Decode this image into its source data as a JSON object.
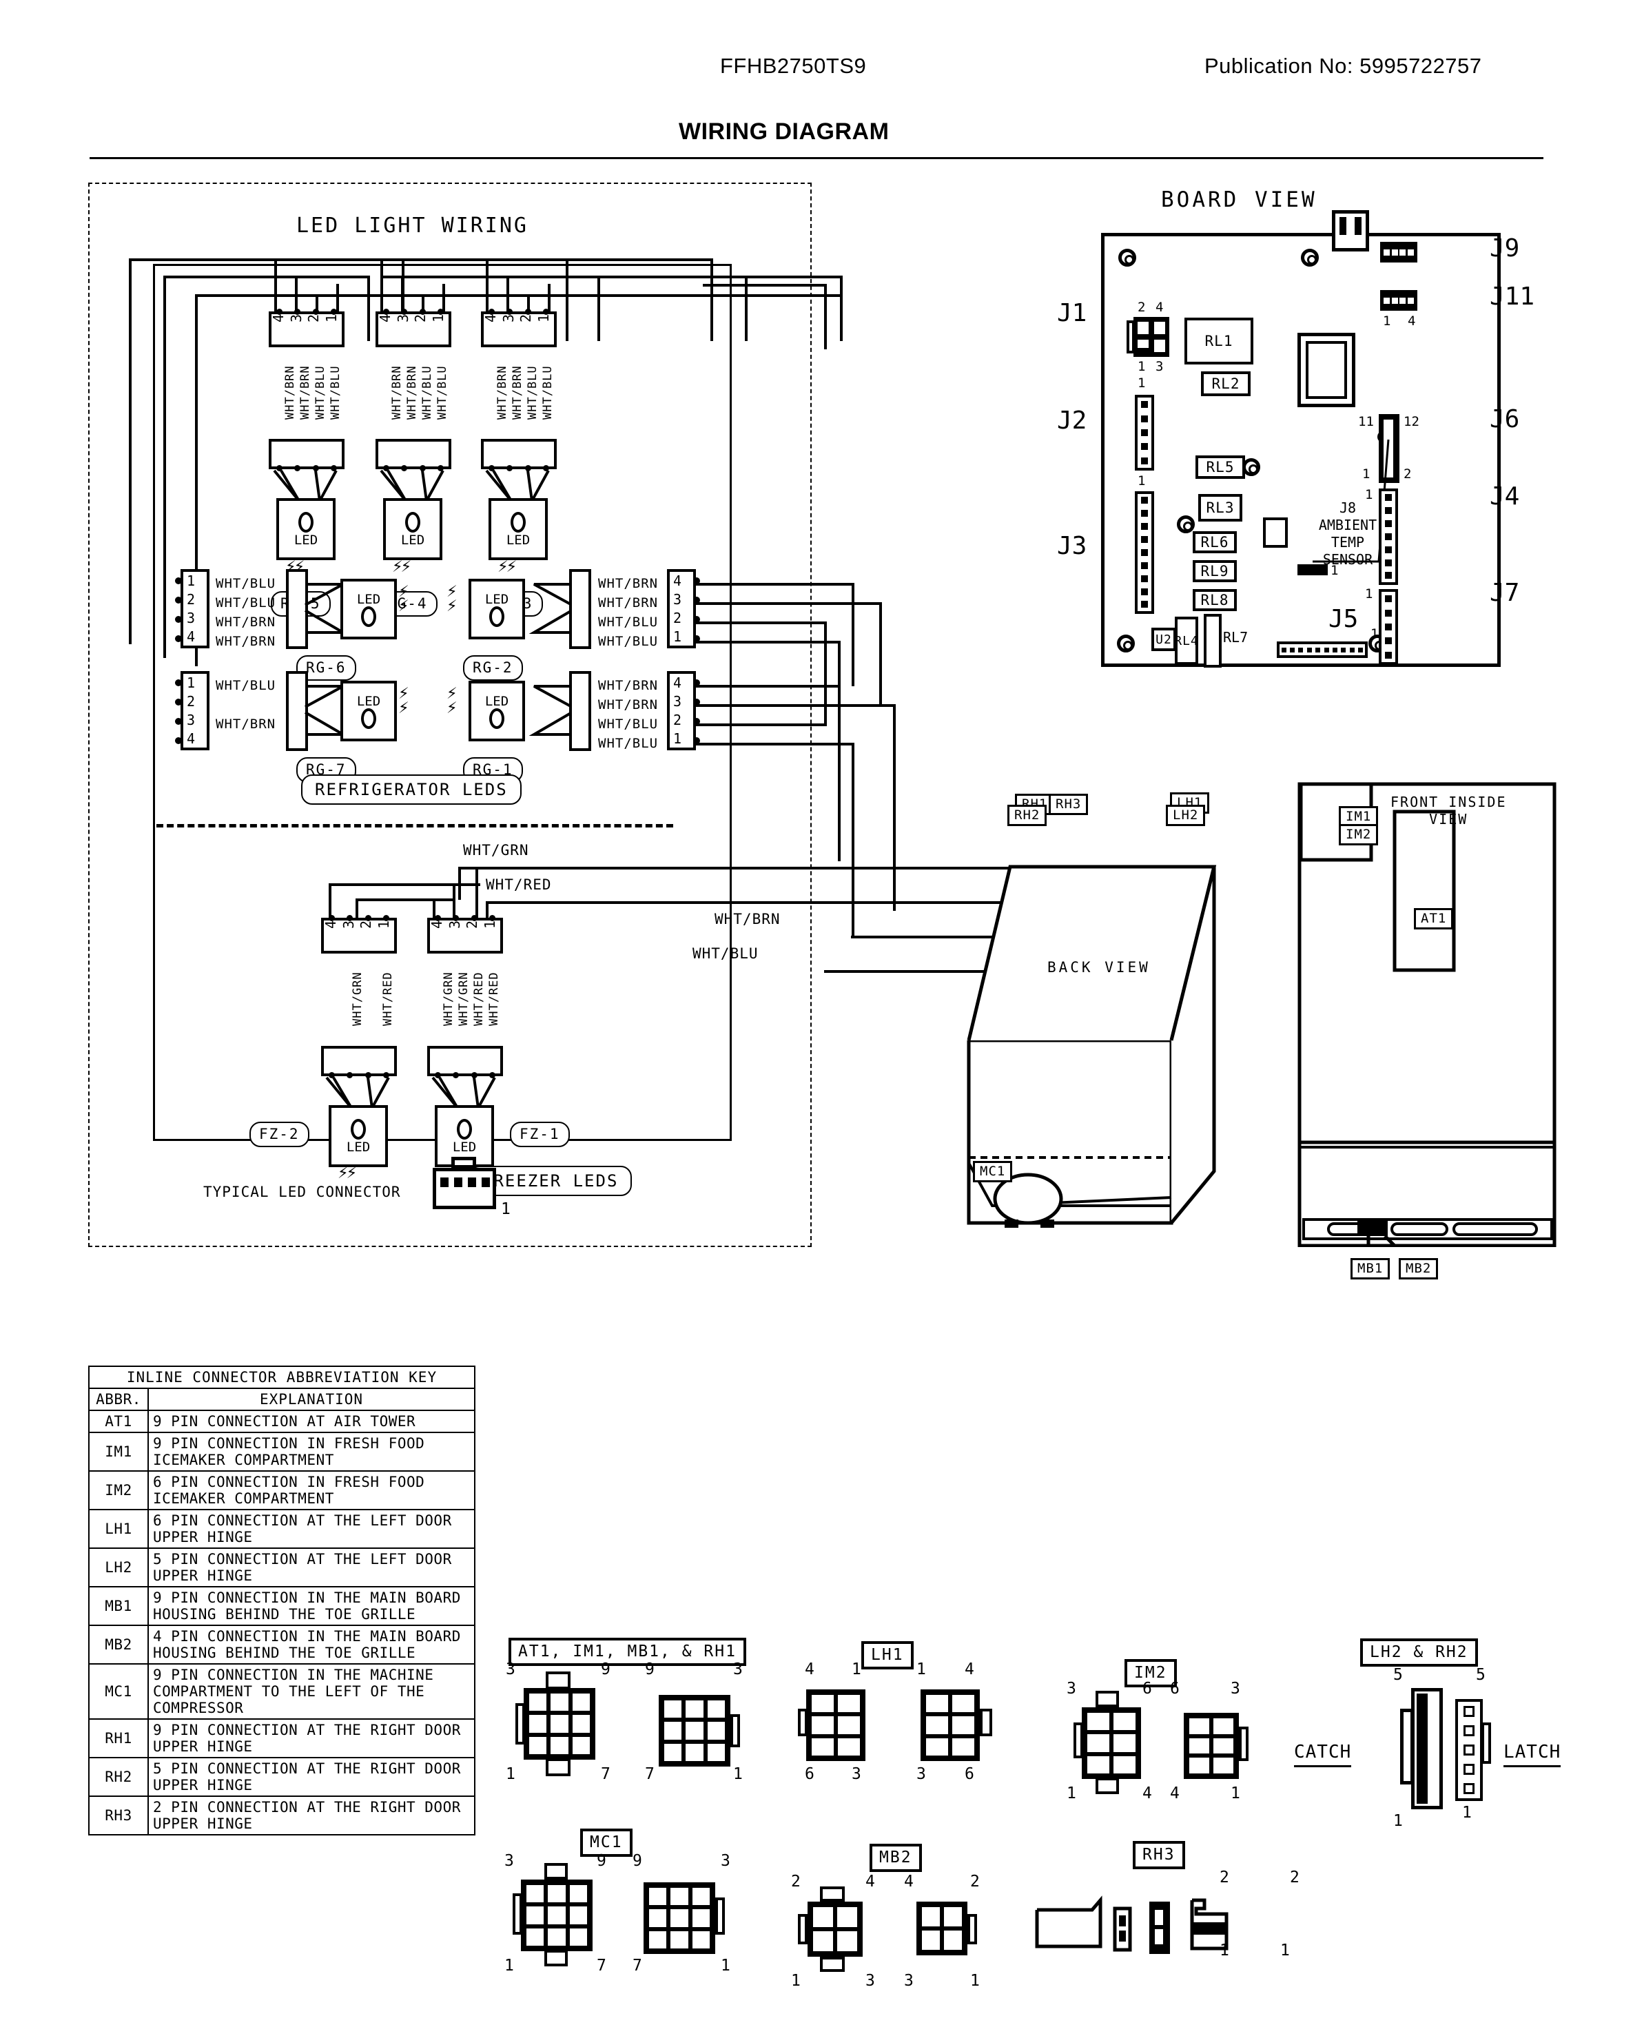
{
  "header": {
    "model": "FFHB2750TS9",
    "publication": "Publication No:  5995722757",
    "title": "WIRING DIAGRAM"
  },
  "led_panel": {
    "title": "LED LIGHT WIRING",
    "refrigerator_leds_label": "REFRIGERATOR LEDS",
    "freezer_leds_label": "FREEZER LEDS",
    "typical_connector_label": "TYPICAL LED CONNECTOR",
    "typical_connector_pin": "1",
    "led_text": "LED",
    "top_connectors": [
      {
        "tag": "RG-5",
        "pins": [
          "4",
          "3",
          "2",
          "1"
        ],
        "wires": [
          "WHT/BRN",
          "WHT/BRN",
          "WHT/BLU",
          "WHT/BLU"
        ]
      },
      {
        "tag": "RG-4",
        "pins": [
          "4",
          "3",
          "2",
          "1"
        ],
        "wires": [
          "WHT/BRN",
          "WHT/BRN",
          "WHT/BLU",
          "WHT/BLU"
        ]
      },
      {
        "tag": "RG-3",
        "pins": [
          "4",
          "3",
          "2",
          "1"
        ],
        "wires": [
          "WHT/BRN",
          "WHT/BRN",
          "WHT/BLU",
          "WHT/BLU"
        ]
      }
    ],
    "left_connectors": [
      {
        "tag": "RG-6",
        "pins": [
          "1",
          "2",
          "3",
          "4"
        ],
        "wires": [
          "WHT/BLU",
          "WHT/BLU",
          "WHT/BRN",
          "WHT/BRN"
        ]
      },
      {
        "tag": "RG-7",
        "pins": [
          "1",
          "2",
          "3",
          "4"
        ],
        "wires": [
          "WHT/BLU",
          "",
          "WHT/BRN",
          ""
        ]
      }
    ],
    "right_connectors": [
      {
        "tag": "RG-2",
        "pins": [
          "4",
          "3",
          "2",
          "1"
        ],
        "wires": [
          "WHT/BRN",
          "WHT/BRN",
          "WHT/BLU",
          "WHT/BLU"
        ]
      },
      {
        "tag": "RG-1",
        "pins": [
          "4",
          "3",
          "2",
          "1"
        ],
        "wires": [
          "WHT/BRN",
          "WHT/BRN",
          "WHT/BLU",
          "WHT/BLU"
        ]
      }
    ],
    "freezer_connectors": [
      {
        "tag": "FZ-2",
        "pins": [
          "4",
          "3",
          "2",
          "1"
        ],
        "wires": [
          "",
          "WHT/GRN",
          "",
          "WHT/RED"
        ]
      },
      {
        "tag": "FZ-1",
        "pins": [
          "4",
          "3",
          "2",
          "1"
        ],
        "wires": [
          "WHT/GRN",
          "WHT/GRN",
          "WHT/RED",
          "WHT/RED"
        ]
      }
    ],
    "bus_labels": {
      "wht_grn": "WHT/GRN",
      "wht_red": "WHT/RED",
      "wht_brn": "WHT/BRN",
      "wht_blu": "WHT/BLU"
    }
  },
  "board_view": {
    "title": "BOARD VIEW",
    "relays": [
      "RL1",
      "RL2",
      "RL5",
      "RL3",
      "RL6",
      "RL9",
      "RL8",
      "RL4",
      "RL7",
      "U2"
    ],
    "connectors": [
      "J1",
      "J2",
      "J3",
      "J9",
      "J11",
      "J6",
      "J4",
      "J7",
      "J5"
    ],
    "j1_pins": {
      "top_left": "2",
      "top_right": "4",
      "bottom_left": "1",
      "bottom_right": "3"
    },
    "j11_pins": {
      "left": "1",
      "right": "4"
    },
    "j6_pins": {
      "top_left": "11",
      "top_right": "12",
      "bottom_left": "1",
      "bottom_right": "2"
    },
    "j2_pin1": "1",
    "j3_pin1": "1",
    "j4_pin1": "1",
    "j7_pin1": "1",
    "j5_pin1": "1",
    "misc_pin1": "1",
    "sensor_label_line1": "J8",
    "sensor_label_line2": "AMBIENT",
    "sensor_label_line3": "TEMP",
    "sensor_label_line4": "SENSOR"
  },
  "back_view": {
    "title": "BACK VIEW",
    "labels": [
      "RH1",
      "RH3",
      "RH2",
      "LH1",
      "LH2",
      "MC1"
    ]
  },
  "front_inside_view": {
    "title_line1": "FRONT INSIDE",
    "title_line2": "VIEW",
    "labels": [
      "IM1",
      "IM2",
      "AT1",
      "MB1",
      "MB2"
    ]
  },
  "key_table": {
    "title": "INLINE CONNECTOR ABBREVIATION KEY",
    "col_abbr": "ABBR.",
    "col_expl": "EXPLANATION",
    "rows": [
      {
        "abbr": "AT1",
        "expl": "9 PIN CONNECTION AT AIR TOWER"
      },
      {
        "abbr": "IM1",
        "expl": "9 PIN CONNECTION IN FRESH FOOD ICEMAKER COMPARTMENT"
      },
      {
        "abbr": "IM2",
        "expl": "6 PIN CONNECTION IN FRESH FOOD ICEMAKER COMPARTMENT"
      },
      {
        "abbr": "LH1",
        "expl": "6 PIN CONNECTION AT THE LEFT DOOR UPPER HINGE"
      },
      {
        "abbr": "LH2",
        "expl": "5 PIN CONNECTION AT THE LEFT DOOR UPPER HINGE"
      },
      {
        "abbr": "MB1",
        "expl": "9 PIN CONNECTION IN THE MAIN BOARD HOUSING BEHIND THE TOE GRILLE"
      },
      {
        "abbr": "MB2",
        "expl": "4 PIN CONNECTION IN THE MAIN BOARD HOUSING BEHIND THE TOE GRILLE"
      },
      {
        "abbr": "MC1",
        "expl": "9 PIN CONNECTION IN THE MACHINE COMPARTMENT TO THE LEFT OF THE COMPRESSOR"
      },
      {
        "abbr": "RH1",
        "expl": "9 PIN CONNECTION AT THE RIGHT DOOR UPPER HINGE"
      },
      {
        "abbr": "RH2",
        "expl": "5 PIN CONNECTION AT THE RIGHT DOOR UPPER HINGE"
      },
      {
        "abbr": "RH3",
        "expl": "2 PIN CONNECTION AT THE RIGHT DOOR UPPER HINGE"
      }
    ]
  },
  "connector_figures": {
    "at1_group": {
      "label": "AT1, IM1, MB1, & RH1",
      "left": [
        "3",
        "9",
        "1",
        "7"
      ],
      "right": [
        "9",
        "3",
        "7",
        "1"
      ]
    },
    "lh1_group": {
      "label": "LH1",
      "left": [
        "4",
        "1",
        "6",
        "3"
      ],
      "right": [
        "1",
        "4",
        "3",
        "6"
      ]
    },
    "im2_group": {
      "label": "IM2",
      "left": [
        "3",
        "6",
        "1",
        "4"
      ],
      "right": [
        "6",
        "3",
        "4",
        "1"
      ]
    },
    "lh2_rh2_group": {
      "label": "LH2 & RH2",
      "catch": "CATCH",
      "latch": "LATCH",
      "left": [
        "5",
        "1"
      ],
      "right": [
        "5",
        "1"
      ]
    },
    "mc1_group": {
      "label": "MC1",
      "left": [
        "3",
        "9",
        "1",
        "7"
      ],
      "right": [
        "9",
        "3",
        "7",
        "1"
      ]
    },
    "mb2_group": {
      "label": "MB2",
      "left": [
        "2",
        "4",
        "1",
        "3"
      ],
      "right": [
        "4",
        "2",
        "3",
        "1"
      ]
    },
    "rh3_group": {
      "label": "RH3",
      "left": [
        "2",
        "1"
      ],
      "right": [
        "2",
        "1"
      ]
    }
  }
}
